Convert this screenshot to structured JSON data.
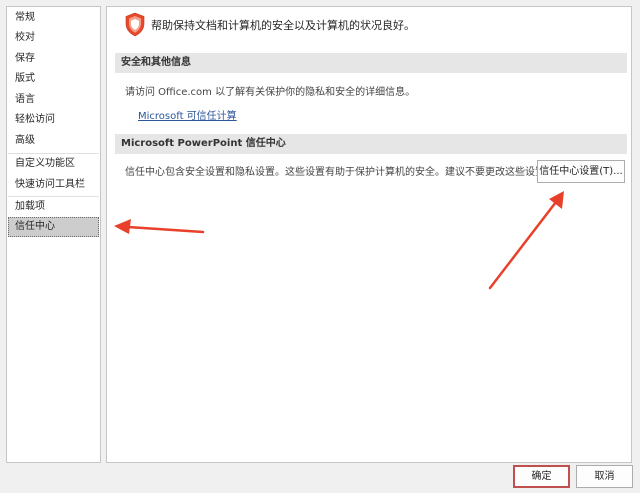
{
  "sidebar": {
    "items": [
      {
        "label": "常规"
      },
      {
        "label": "校对"
      },
      {
        "label": "保存"
      },
      {
        "label": "版式"
      },
      {
        "label": "语言"
      },
      {
        "label": "轻松访问"
      },
      {
        "label": "高级"
      },
      {
        "label": "自定义功能区"
      },
      {
        "label": "快速访问工具栏"
      },
      {
        "label": "加载项"
      },
      {
        "label": "信任中心",
        "selected": true
      }
    ]
  },
  "main": {
    "header_text": "帮助保持文档和计算机的安全以及计算机的状况良好。",
    "security_section": {
      "title": "安全和其他信息",
      "description": "请访问 Office.com 以了解有关保护你的隐私和安全的详细信息。",
      "link_label": "Microsoft 可信任计算"
    },
    "trust_center_section": {
      "title": "Microsoft PowerPoint 信任中心",
      "description": "信任中心包含安全设置和隐私设置。这些设置有助于保护计算机的安全。建议不要更改这些设置。",
      "settings_button_label": "信任中心设置(T)..."
    }
  },
  "footer": {
    "ok_label": "确定",
    "cancel_label": "取消"
  },
  "colors": {
    "accent": "#c0504d",
    "shield": "#e8492b",
    "link": "#2b579a",
    "annotation_arrow": "#e8402b"
  }
}
